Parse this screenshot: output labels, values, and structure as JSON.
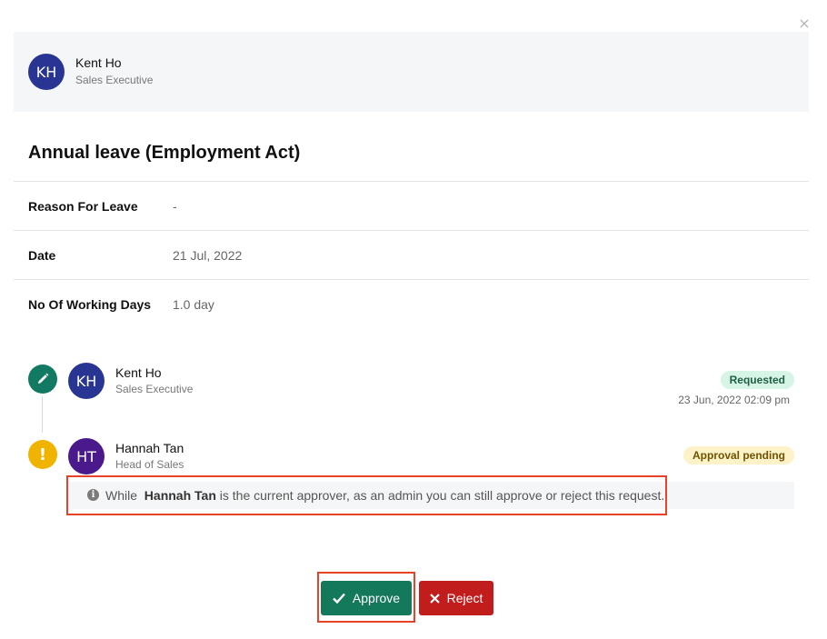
{
  "dialog": {
    "close_symbol": "×"
  },
  "employee": {
    "initials": "KH",
    "name": "Kent Ho",
    "role": "Sales Executive",
    "avatar_color": "#283593"
  },
  "leave": {
    "title": "Annual leave (Employment Act)",
    "details": [
      {
        "label": "Reason For Leave",
        "value": "-"
      },
      {
        "label": "Date",
        "value": "21 Jul, 2022"
      },
      {
        "label": "No Of Working Days",
        "value": "1.0 day"
      }
    ]
  },
  "timeline": [
    {
      "icon": "pencil-icon",
      "icon_color": "#127a62",
      "initials": "KH",
      "avatar_color": "#283593",
      "name": "Kent Ho",
      "role": "Sales Executive",
      "status": "Requested",
      "date": "23 Jun, 2022 02:09 pm"
    },
    {
      "icon": "exclamation-icon",
      "icon_color": "#f0b400",
      "initials": "HT",
      "avatar_color": "#4a1a8c",
      "name": "Hannah Tan",
      "role": "Head of Sales",
      "status": "Approval pending"
    }
  ],
  "notice": {
    "prefix": "While",
    "approver": "Hannah Tan",
    "suffix": "is the current approver, as an admin you can still approve or reject this request."
  },
  "actions": {
    "approve_label": "Approve",
    "reject_label": "Reject",
    "approve_color": "#14785a",
    "reject_color": "#c21d1d"
  }
}
